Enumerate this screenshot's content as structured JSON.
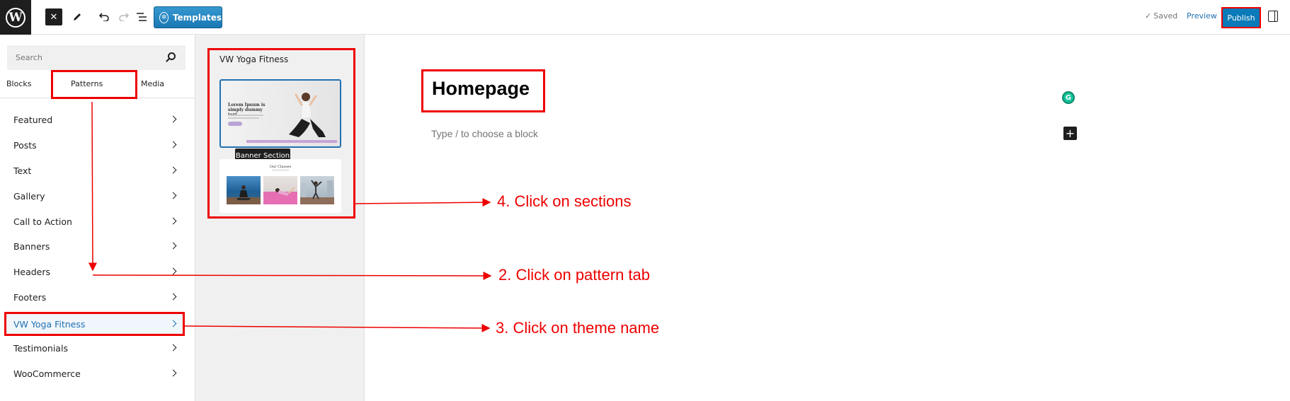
{
  "topbar": {
    "logo_letter": "W",
    "close_glyph": "✕",
    "templates_label": "Templates",
    "saved_label": "Saved",
    "saved_check": "✓",
    "preview_label": "Preview",
    "publish_label": "Publish"
  },
  "inserter": {
    "search_placeholder": "Search",
    "tabs": [
      "Blocks",
      "Patterns",
      "Media"
    ],
    "categories": [
      "Featured",
      "Posts",
      "Text",
      "Gallery",
      "Call to Action",
      "Banners",
      "Headers",
      "Footers",
      "VW Yoga Fitness",
      "Testimonials",
      "WooCommerce"
    ],
    "active_category": "VW Yoga Fitness"
  },
  "patterns": {
    "group_title": "VW Yoga Fitness",
    "banner_heading": "Lorem Ipsum is simply dummy text",
    "tooltip": "Banner Section",
    "classes_title": "Our Classes"
  },
  "editor": {
    "page_title": "Homepage",
    "block_placeholder": "Type / to choose a block",
    "grammarly_letter": "G",
    "add_glyph": "+"
  },
  "annotations": {
    "step2": "2. Click on pattern tab",
    "step3": "3. Click on theme name",
    "step4": "4. Click on sections",
    "color": "#ee0000"
  }
}
